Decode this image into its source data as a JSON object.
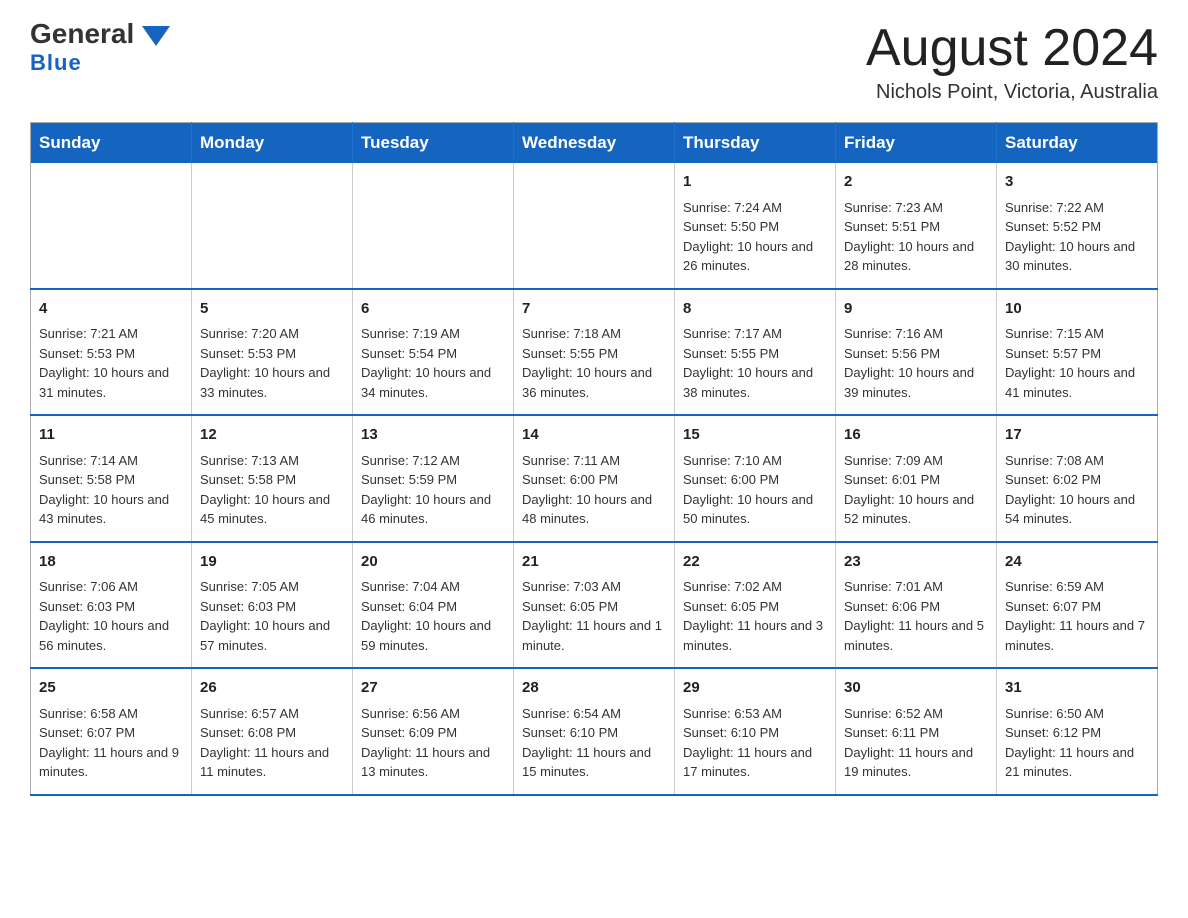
{
  "header": {
    "logo_general": "General",
    "logo_blue": "Blue",
    "month_title": "August 2024",
    "location": "Nichols Point, Victoria, Australia"
  },
  "days_of_week": [
    "Sunday",
    "Monday",
    "Tuesday",
    "Wednesday",
    "Thursday",
    "Friday",
    "Saturday"
  ],
  "weeks": [
    {
      "days": [
        {
          "number": "",
          "info": ""
        },
        {
          "number": "",
          "info": ""
        },
        {
          "number": "",
          "info": ""
        },
        {
          "number": "",
          "info": ""
        },
        {
          "number": "1",
          "info": "Sunrise: 7:24 AM\nSunset: 5:50 PM\nDaylight: 10 hours and 26 minutes."
        },
        {
          "number": "2",
          "info": "Sunrise: 7:23 AM\nSunset: 5:51 PM\nDaylight: 10 hours and 28 minutes."
        },
        {
          "number": "3",
          "info": "Sunrise: 7:22 AM\nSunset: 5:52 PM\nDaylight: 10 hours and 30 minutes."
        }
      ]
    },
    {
      "days": [
        {
          "number": "4",
          "info": "Sunrise: 7:21 AM\nSunset: 5:53 PM\nDaylight: 10 hours and 31 minutes."
        },
        {
          "number": "5",
          "info": "Sunrise: 7:20 AM\nSunset: 5:53 PM\nDaylight: 10 hours and 33 minutes."
        },
        {
          "number": "6",
          "info": "Sunrise: 7:19 AM\nSunset: 5:54 PM\nDaylight: 10 hours and 34 minutes."
        },
        {
          "number": "7",
          "info": "Sunrise: 7:18 AM\nSunset: 5:55 PM\nDaylight: 10 hours and 36 minutes."
        },
        {
          "number": "8",
          "info": "Sunrise: 7:17 AM\nSunset: 5:55 PM\nDaylight: 10 hours and 38 minutes."
        },
        {
          "number": "9",
          "info": "Sunrise: 7:16 AM\nSunset: 5:56 PM\nDaylight: 10 hours and 39 minutes."
        },
        {
          "number": "10",
          "info": "Sunrise: 7:15 AM\nSunset: 5:57 PM\nDaylight: 10 hours and 41 minutes."
        }
      ]
    },
    {
      "days": [
        {
          "number": "11",
          "info": "Sunrise: 7:14 AM\nSunset: 5:58 PM\nDaylight: 10 hours and 43 minutes."
        },
        {
          "number": "12",
          "info": "Sunrise: 7:13 AM\nSunset: 5:58 PM\nDaylight: 10 hours and 45 minutes."
        },
        {
          "number": "13",
          "info": "Sunrise: 7:12 AM\nSunset: 5:59 PM\nDaylight: 10 hours and 46 minutes."
        },
        {
          "number": "14",
          "info": "Sunrise: 7:11 AM\nSunset: 6:00 PM\nDaylight: 10 hours and 48 minutes."
        },
        {
          "number": "15",
          "info": "Sunrise: 7:10 AM\nSunset: 6:00 PM\nDaylight: 10 hours and 50 minutes."
        },
        {
          "number": "16",
          "info": "Sunrise: 7:09 AM\nSunset: 6:01 PM\nDaylight: 10 hours and 52 minutes."
        },
        {
          "number": "17",
          "info": "Sunrise: 7:08 AM\nSunset: 6:02 PM\nDaylight: 10 hours and 54 minutes."
        }
      ]
    },
    {
      "days": [
        {
          "number": "18",
          "info": "Sunrise: 7:06 AM\nSunset: 6:03 PM\nDaylight: 10 hours and 56 minutes."
        },
        {
          "number": "19",
          "info": "Sunrise: 7:05 AM\nSunset: 6:03 PM\nDaylight: 10 hours and 57 minutes."
        },
        {
          "number": "20",
          "info": "Sunrise: 7:04 AM\nSunset: 6:04 PM\nDaylight: 10 hours and 59 minutes."
        },
        {
          "number": "21",
          "info": "Sunrise: 7:03 AM\nSunset: 6:05 PM\nDaylight: 11 hours and 1 minute."
        },
        {
          "number": "22",
          "info": "Sunrise: 7:02 AM\nSunset: 6:05 PM\nDaylight: 11 hours and 3 minutes."
        },
        {
          "number": "23",
          "info": "Sunrise: 7:01 AM\nSunset: 6:06 PM\nDaylight: 11 hours and 5 minutes."
        },
        {
          "number": "24",
          "info": "Sunrise: 6:59 AM\nSunset: 6:07 PM\nDaylight: 11 hours and 7 minutes."
        }
      ]
    },
    {
      "days": [
        {
          "number": "25",
          "info": "Sunrise: 6:58 AM\nSunset: 6:07 PM\nDaylight: 11 hours and 9 minutes."
        },
        {
          "number": "26",
          "info": "Sunrise: 6:57 AM\nSunset: 6:08 PM\nDaylight: 11 hours and 11 minutes."
        },
        {
          "number": "27",
          "info": "Sunrise: 6:56 AM\nSunset: 6:09 PM\nDaylight: 11 hours and 13 minutes."
        },
        {
          "number": "28",
          "info": "Sunrise: 6:54 AM\nSunset: 6:10 PM\nDaylight: 11 hours and 15 minutes."
        },
        {
          "number": "29",
          "info": "Sunrise: 6:53 AM\nSunset: 6:10 PM\nDaylight: 11 hours and 17 minutes."
        },
        {
          "number": "30",
          "info": "Sunrise: 6:52 AM\nSunset: 6:11 PM\nDaylight: 11 hours and 19 minutes."
        },
        {
          "number": "31",
          "info": "Sunrise: 6:50 AM\nSunset: 6:12 PM\nDaylight: 11 hours and 21 minutes."
        }
      ]
    }
  ]
}
